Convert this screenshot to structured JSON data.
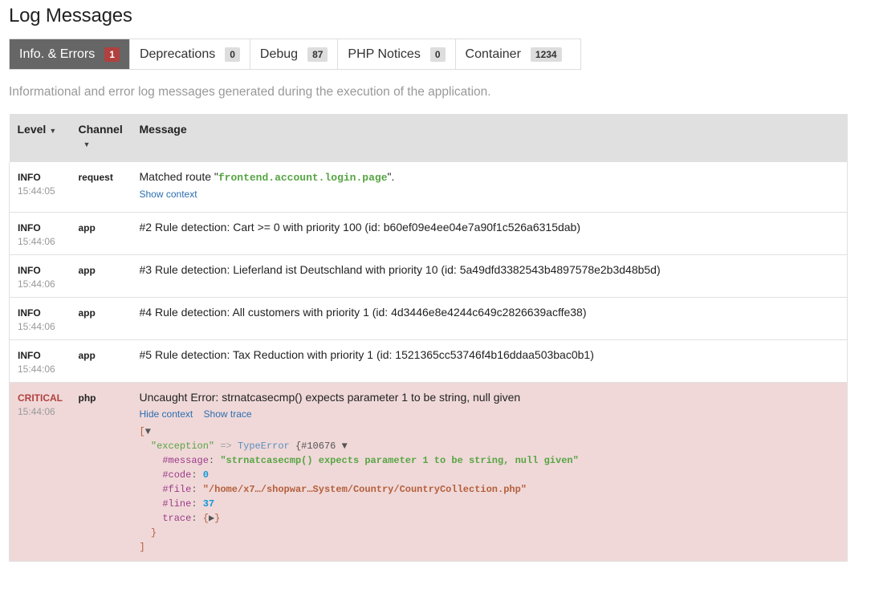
{
  "page_title": "Log Messages",
  "tabs": [
    {
      "label": "Info. & Errors",
      "count": "1",
      "active": true
    },
    {
      "label": "Deprecations",
      "count": "0",
      "active": false
    },
    {
      "label": "Debug",
      "count": "87",
      "active": false
    },
    {
      "label": "PHP Notices",
      "count": "0",
      "active": false
    },
    {
      "label": "Container",
      "count": "1234",
      "active": false
    }
  ],
  "description": "Informational and error log messages generated during the execution of the application.",
  "table": {
    "headers": {
      "level": "Level",
      "channel": "Channel",
      "message": "Message"
    },
    "rows": [
      {
        "level": "INFO",
        "time": "15:44:05",
        "channel": "request",
        "message_prefix": "Matched route \"",
        "message_route": "frontend.account.login.page",
        "message_suffix": "\".",
        "link1": "Show context"
      },
      {
        "level": "INFO",
        "time": "15:44:06",
        "channel": "app",
        "message": "#2 Rule detection: Cart >= 0 with priority 100 (id: b60ef09e4ee04e7a90f1c526a6315dab)"
      },
      {
        "level": "INFO",
        "time": "15:44:06",
        "channel": "app",
        "message": "#3 Rule detection: Lieferland ist Deutschland with priority 10 (id: 5a49dfd3382543b4897578e2b3d48b5d)"
      },
      {
        "level": "INFO",
        "time": "15:44:06",
        "channel": "app",
        "message": "#4 Rule detection: All customers with priority 1 (id: 4d3446e8e4244c649c2826639acffe38)"
      },
      {
        "level": "INFO",
        "time": "15:44:06",
        "channel": "app",
        "message": "#5 Rule detection: Tax Reduction with priority 1 (id: 1521365cc53746f4b16ddaa503bac0b1)"
      },
      {
        "level": "CRITICAL",
        "time": "15:44:06",
        "channel": "php",
        "message": "Uncaught Error: strnatcasecmp() expects parameter 1 to be string, null given",
        "link1": "Hide context",
        "link2": "Show trace"
      }
    ]
  },
  "dump": {
    "open_bracket": "[",
    "close_bracket": "]",
    "toggle_down": "▼",
    "toggle_right": "▶",
    "exception_key": "\"exception\"",
    "arrow": "=>",
    "class_name": "TypeError",
    "object_open": "{",
    "object_id": "#10676",
    "object_close": "}",
    "message_key": "#message",
    "message_value": "\"strnatcasecmp() expects parameter 1 to be string, null given\"",
    "code_key": "#code",
    "code_value": "0",
    "file_key": "#file",
    "file_value": "\"/home/x7…/shopwar…System/Country/CountryCollection.php\"",
    "line_key": "#line",
    "line_value": "37",
    "trace_key": "trace",
    "trace_open": "{",
    "trace_close": "}",
    "colon": ":"
  },
  "colors": {
    "active_tab_bg": "#666666",
    "critical_badge": "#b0413e",
    "critical_row_bg": "#f0d8d8",
    "link": "#2b6eb0",
    "route_green": "#56a543"
  }
}
